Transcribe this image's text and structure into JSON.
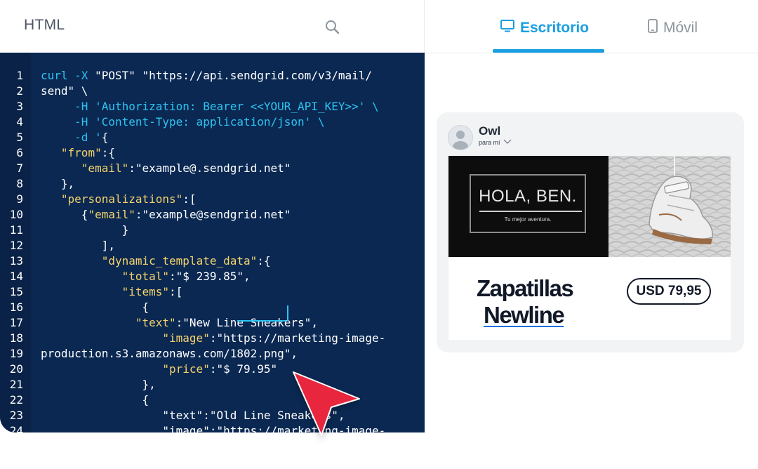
{
  "editor": {
    "title": "HTML",
    "search_icon": "search-icon",
    "lines": [
      {
        "n": "1",
        "segs": [
          {
            "t": "curl -X ",
            "c": "cyan"
          },
          {
            "t": "\"POST\" \"https://api.sendgrid.com/v3/mail/",
            "c": "white"
          }
        ]
      },
      {
        "n": "2",
        "segs": [
          {
            "t": "send\" \\",
            "c": "white"
          }
        ]
      },
      {
        "n": "3",
        "segs": [
          {
            "t": "     -H 'Authorization: Bearer <<YOUR_API_KEY>>' \\",
            "c": "cyan"
          }
        ]
      },
      {
        "n": "4",
        "segs": [
          {
            "t": "     -H 'Content-Type: application/json' \\",
            "c": "cyan"
          }
        ]
      },
      {
        "n": "5",
        "segs": [
          {
            "t": "     -d '",
            "c": "cyan"
          },
          {
            "t": "{",
            "c": "white"
          }
        ]
      },
      {
        "n": "6",
        "segs": [
          {
            "t": "   ",
            "c": "white"
          },
          {
            "t": "\"from\"",
            "c": "yellow"
          },
          {
            "t": ":{",
            "c": "white"
          }
        ]
      },
      {
        "n": "7",
        "segs": [
          {
            "t": "      ",
            "c": "white"
          },
          {
            "t": "\"email\"",
            "c": "yellow"
          },
          {
            "t": ":\"example@.sendgrid.net\"",
            "c": "white"
          }
        ]
      },
      {
        "n": "8",
        "segs": [
          {
            "t": "   },",
            "c": "white"
          }
        ]
      },
      {
        "n": "9",
        "segs": [
          {
            "t": "   ",
            "c": "white"
          },
          {
            "t": "\"personalizations\"",
            "c": "yellow"
          },
          {
            "t": ":[",
            "c": "white"
          }
        ]
      },
      {
        "n": "10",
        "segs": [
          {
            "t": "      {",
            "c": "white"
          },
          {
            "t": "\"email\"",
            "c": "yellow"
          },
          {
            "t": ":\"example@sendgrid.net\"",
            "c": "white"
          }
        ]
      },
      {
        "n": "11",
        "segs": [
          {
            "t": "            }",
            "c": "white"
          }
        ]
      },
      {
        "n": "12",
        "segs": [
          {
            "t": "         ],",
            "c": "white"
          }
        ]
      },
      {
        "n": "13",
        "segs": [
          {
            "t": "         ",
            "c": "white"
          },
          {
            "t": "\"dynamic_template_data\"",
            "c": "yellow"
          },
          {
            "t": ":{",
            "c": "white"
          }
        ]
      },
      {
        "n": "14",
        "segs": [
          {
            "t": "            ",
            "c": "white"
          },
          {
            "t": "\"total\"",
            "c": "yellow"
          },
          {
            "t": ":\"$ 239.85\",",
            "c": "white"
          }
        ]
      },
      {
        "n": "15",
        "segs": [
          {
            "t": "            ",
            "c": "white"
          },
          {
            "t": "\"items\"",
            "c": "yellow"
          },
          {
            "t": ":[",
            "c": "white"
          }
        ]
      },
      {
        "n": "16",
        "segs": [
          {
            "t": "               {",
            "c": "white"
          }
        ]
      },
      {
        "n": "17",
        "segs": [
          {
            "t": "              ",
            "c": "white"
          },
          {
            "t": "\"text\"",
            "c": "yellow"
          },
          {
            "t": ":\"New Line Sneakers\",",
            "c": "white"
          }
        ]
      },
      {
        "n": "18",
        "segs": [
          {
            "t": "                  ",
            "c": "white"
          },
          {
            "t": "\"image\"",
            "c": "yellow"
          },
          {
            "t": ":\"https://marketing-image-",
            "c": "white"
          }
        ]
      },
      {
        "n": "19",
        "segs": [
          {
            "t": "production.s3.amazonaws.com/1802.png\",",
            "c": "white"
          }
        ]
      },
      {
        "n": "20",
        "segs": [
          {
            "t": "                  ",
            "c": "white"
          },
          {
            "t": "\"price\"",
            "c": "yellow"
          },
          {
            "t": ":\"$ 79.95\"",
            "c": "white"
          }
        ]
      },
      {
        "n": "21",
        "segs": [
          {
            "t": "               },",
            "c": "white"
          }
        ]
      },
      {
        "n": "22",
        "segs": [
          {
            "t": "               {",
            "c": "white"
          }
        ]
      },
      {
        "n": "23",
        "segs": [
          {
            "t": "                  ",
            "c": "white"
          },
          {
            "t": "\"text\":\"Old Line Sneakers\",",
            "c": "white"
          }
        ]
      },
      {
        "n": "24",
        "segs": [
          {
            "t": "                  ",
            "c": "white"
          },
          {
            "t": "\"image\":\"https://marketing-image-",
            "c": "white"
          }
        ]
      }
    ]
  },
  "preview": {
    "tabs": [
      {
        "label": "Escritorio",
        "icon": "desktop-icon",
        "active": true
      },
      {
        "label": "Móvil",
        "icon": "mobile-phone-icon",
        "active": false
      }
    ],
    "accent_color": "#1a9fe0",
    "email": {
      "sender": "Owl",
      "recipient": "para mí",
      "hero_title": "HOLA, BEN.",
      "hero_subtitle": "Tu mejor aventura.",
      "product_name_line1": "Zapatillas",
      "product_name_line2": "Newline",
      "price": "USD 79,95"
    }
  },
  "colors": {
    "editor_bg": "#0a2852",
    "keyword_cyan": "#2ec4f2",
    "key_yellow": "#f5d36b",
    "cursor_red": "#e8283c"
  }
}
